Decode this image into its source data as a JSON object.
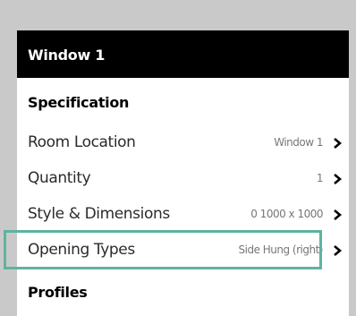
{
  "panel": {
    "title": "Window 1"
  },
  "sections": {
    "specification": "Specification",
    "profiles": "Profiles"
  },
  "rows": [
    {
      "label": "Room Location",
      "value": "Window 1"
    },
    {
      "label": "Quantity",
      "value": "1"
    },
    {
      "label": "Style & Dimensions",
      "value": "0 1000 x 1000"
    },
    {
      "label": "Opening Types",
      "value": "Side Hung (right)"
    }
  ],
  "icons": {
    "row_chevron": "chevron-right-icon"
  },
  "colors": {
    "background": "#c9c9c9",
    "header_bg": "#000000",
    "panel_bg": "#ffffff",
    "highlight": "#5fb3a0",
    "value_text": "#777777"
  }
}
